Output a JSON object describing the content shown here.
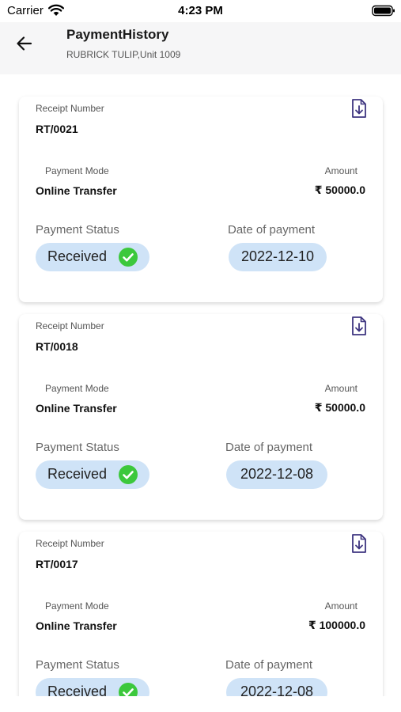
{
  "status_bar": {
    "carrier": "Carrier",
    "time": "4:23 PM",
    "icons": [
      "wifi-icon",
      "battery-icon"
    ]
  },
  "header": {
    "back_icon": "arrow-left-icon",
    "title": "PaymentHistory",
    "subtitle": "RUBRICK TULIP,Unit 1009"
  },
  "labels": {
    "receipt_number": "Receipt Number",
    "payment_mode": "Payment Mode",
    "amount": "Amount",
    "payment_status": "Payment Status",
    "date_of_payment": "Date of payment"
  },
  "colors": {
    "badge_bg": "#cfe3f7",
    "check_green": "#3cc83c",
    "download_icon": "#3e3580",
    "header_bg": "#f6f6f7"
  },
  "payments": [
    {
      "receipt_number": "RT/0021",
      "mode": "Online Transfer",
      "amount": "₹ 50000.0",
      "status": "Received",
      "date": "2022-12-10",
      "download_icon": "file-download-icon",
      "status_icon": "check-circle-icon"
    },
    {
      "receipt_number": "RT/0018",
      "mode": "Online Transfer",
      "amount": "₹ 50000.0",
      "status": "Received",
      "date": "2022-12-08",
      "download_icon": "file-download-icon",
      "status_icon": "check-circle-icon"
    },
    {
      "receipt_number": "RT/0017",
      "mode": "Online Transfer",
      "amount": "₹ 100000.0",
      "status": "Received",
      "date": "2022-12-08",
      "download_icon": "file-download-icon",
      "status_icon": "check-circle-icon"
    }
  ]
}
